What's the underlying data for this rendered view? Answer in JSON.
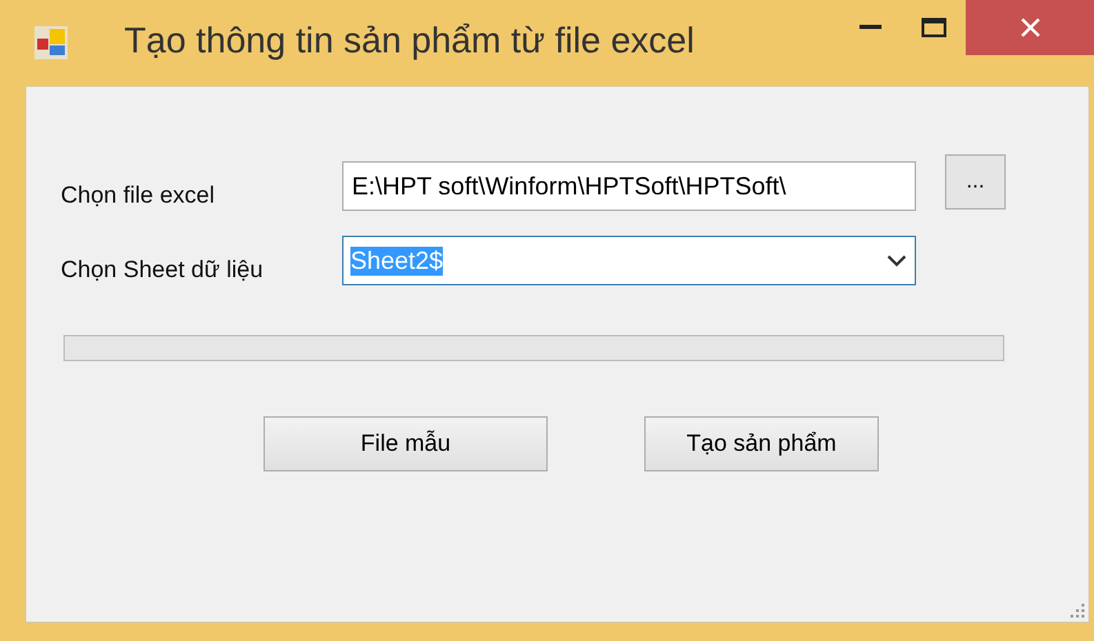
{
  "window": {
    "title": "Tạo thông tin sản phẩm từ file excel"
  },
  "file_row": {
    "label": "Chọn file excel",
    "value": "E:\\HPT soft\\Winform\\HPTSoft\\HPTSoft\\",
    "browse_button": "..."
  },
  "sheet_row": {
    "label": "Chọn Sheet dữ liệu",
    "value": "Sheet2$",
    "text_selected": true
  },
  "buttons": [
    "File mẫu",
    "Tạo sản phẩm"
  ]
}
